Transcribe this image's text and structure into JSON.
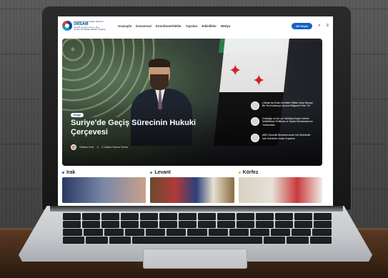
{
  "site": {
    "logo": {
      "line1": "Ortadoğu Araştırmaları Merkezi",
      "acronym": "ORSAM",
      "line2": "مركز دراسات الشرق الأوسط",
      "line3": "Center for Middle Eastern Studies"
    },
    "menu": [
      "Anasayfa",
      "Konsensal",
      "Koordinatörlükler",
      "Yayınlar",
      "Etkinlikler",
      "Medya"
    ],
    "language_button": "Dil Seçin",
    "icons": [
      "search-icon",
      "menu-icon"
    ]
  },
  "hero": {
    "tag": "Bölge",
    "title": "Suriye'de Geçiş Sürecinin Hukuki Çerçevesi",
    "author": "Gökhan Ereli",
    "read_time": "2 Dakika Okuma Süresi",
    "side_items": [
      "Lübnan'da Ortak Devletleri İttifakı Karşı Barışçıl Bir Yeni Kamuoyu Uyumu Bölgesel Krize Yol",
      "Ortadoğu ve Ak Lav Tahkikiye Ilışkin Kelime Müttefikimiz Politikası ve Siyasi Dilemmalarının Yansımaları",
      "ABD Güvenlik Binamenızında Yeni Belirsizlik: Irak Üzerinden İnsan Kuşatma"
    ]
  },
  "sections": [
    {
      "label": "Irak",
      "color": "#1563c0"
    },
    {
      "label": "Levant",
      "color": "#2e9b4a"
    },
    {
      "label": "Körfez",
      "color": "#e0b21c"
    }
  ]
}
